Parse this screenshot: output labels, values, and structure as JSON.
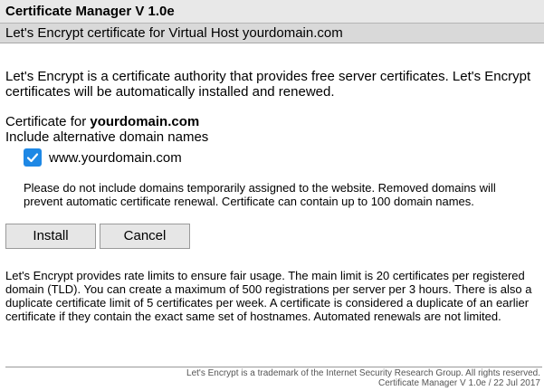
{
  "window": {
    "title": "Certificate Manager V 1.0e",
    "subtitle": "Let's Encrypt certificate for Virtual Host yourdomain.com"
  },
  "intro": "Let's Encrypt is a certificate authority that provides free server certificates. Let's Encrypt certificates will be automatically installed and renewed.",
  "certificate": {
    "label": "Certificate for ",
    "domain": "yourdomain.com",
    "alt_label": "Include alternative domain names",
    "alt_domains": [
      {
        "name": "www.yourdomain.com",
        "checked": true
      }
    ],
    "note": "Please do not include domains temporarily assigned to the website. Removed domains will prevent automatic certificate renewal. Certificate can contain up to 100 domain names."
  },
  "buttons": {
    "install": "Install",
    "cancel": "Cancel"
  },
  "rate_limits": "Let's Encrypt provides rate limits to ensure fair usage. The main limit is 20 certificates per registered domain (TLD). You can create a maximum of 500 registrations per server per 3 hours. There is also a duplicate certificate limit of 5 certificates per week. A certificate is considered a duplicate of an earlier certificate if they contain the exact same set of hostnames. Automated renewals are not limited.",
  "footer": {
    "trademark": "Let's Encrypt is a trademark of the Internet Security Research Group. All rights reserved.",
    "version": "Certificate Manager V 1.0e / 22 Jul 2017"
  },
  "colors": {
    "checkbox": "#1e88e5",
    "title_bar": "#e8e8e8",
    "subtitle_bar": "#d9d9d9",
    "button": "#e6e6e6"
  },
  "icons": {
    "checkbox": "check-icon"
  }
}
